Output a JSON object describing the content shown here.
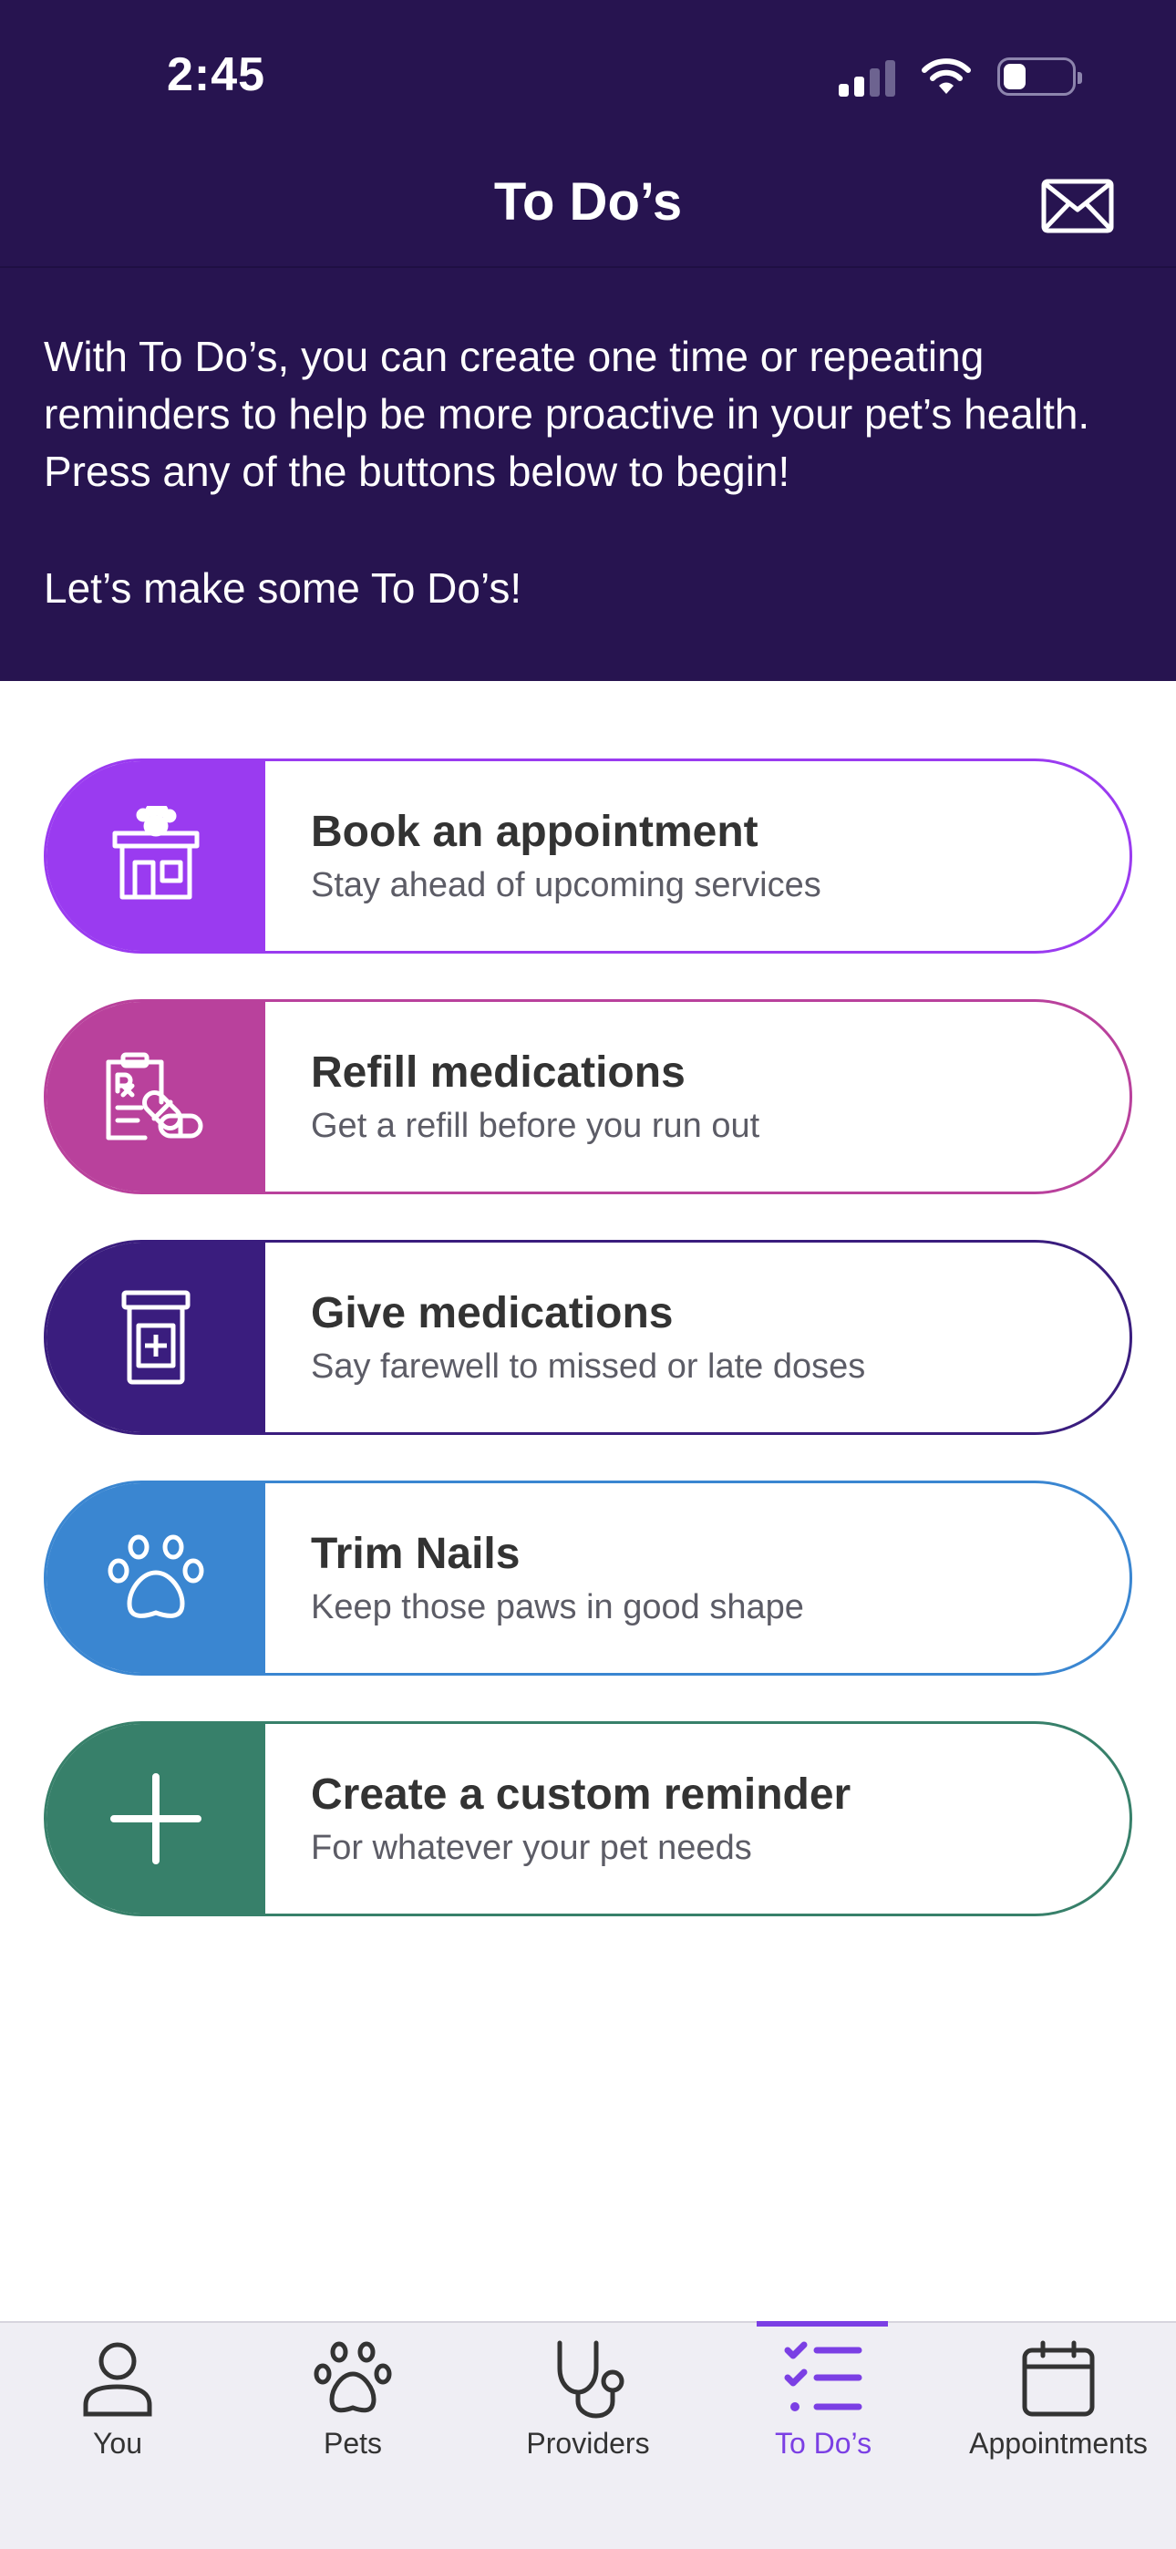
{
  "status_bar": {
    "time": "2:45"
  },
  "nav": {
    "title": "To Do’s"
  },
  "intro": {
    "text": "With To Do’s, you can create one time or repeating reminders to help be more proactive in your pet’s health. Press any of the buttons below to begin!",
    "cta": "Let’s make some To Do’s!"
  },
  "cards": [
    {
      "title": "Book an appointment",
      "subtitle": "Stay ahead of upcoming services",
      "color": "#9a3bf0",
      "icon": "clinic-paw-icon"
    },
    {
      "title": "Refill medications",
      "subtitle": "Get a refill before you run out",
      "color": "#b9419c",
      "icon": "prescription-pills-icon"
    },
    {
      "title": "Give medications",
      "subtitle": "Say farewell to missed or late doses",
      "color": "#3a1d7e",
      "icon": "medicine-bottle-icon"
    },
    {
      "title": "Trim Nails",
      "subtitle": "Keep those paws in good shape",
      "color": "#3a86d1",
      "icon": "paw-icon"
    },
    {
      "title": "Create a custom reminder",
      "subtitle": "For whatever your pet needs",
      "color": "#37806a",
      "icon": "plus-icon"
    }
  ],
  "tabs": [
    {
      "label": "You",
      "icon": "person-icon",
      "active": false
    },
    {
      "label": "Pets",
      "icon": "paw-icon",
      "active": false
    },
    {
      "label": "Providers",
      "icon": "stethoscope-icon",
      "active": false
    },
    {
      "label": "To Do’s",
      "icon": "checklist-icon",
      "active": true
    },
    {
      "label": "Appointments",
      "icon": "calendar-icon",
      "active": false
    }
  ],
  "colors": {
    "header_bg": "#271450",
    "active_tab": "#7b3fe4"
  }
}
